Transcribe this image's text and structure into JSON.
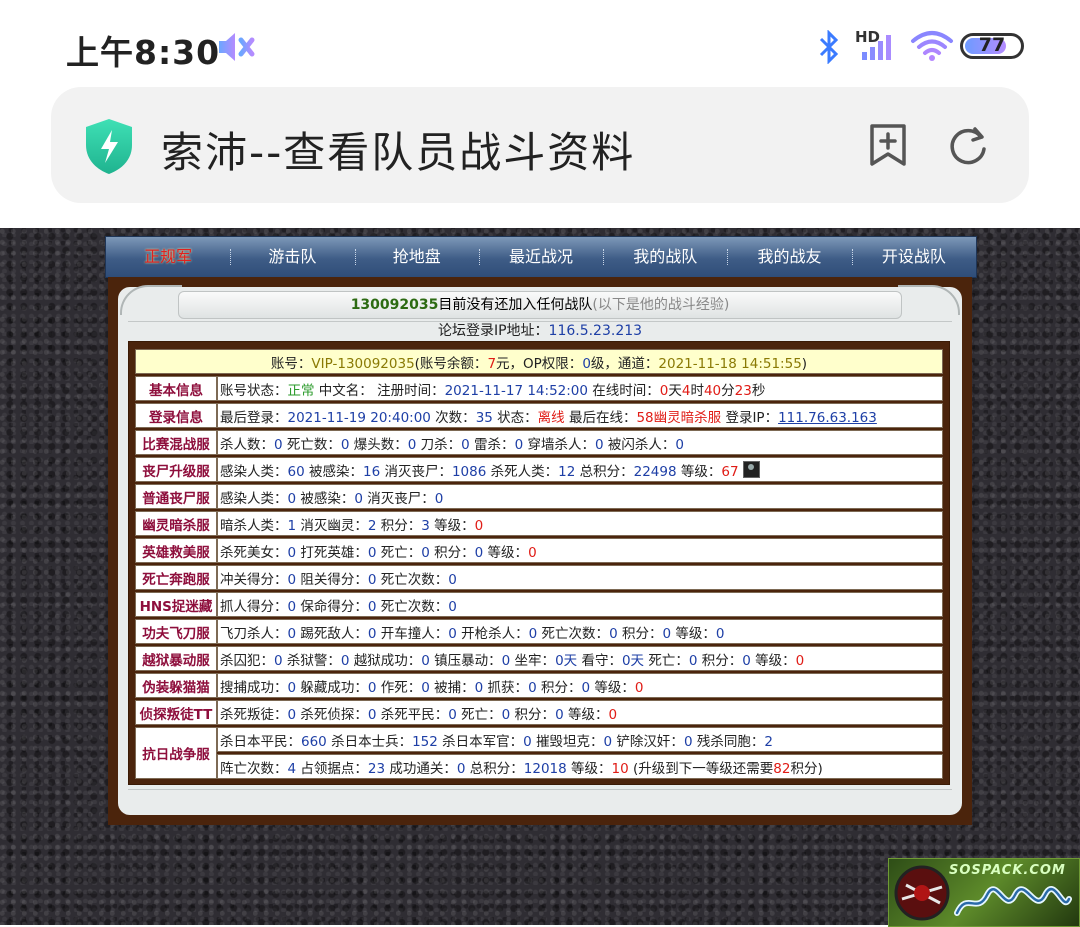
{
  "status_bar": {
    "time": "上午8:30",
    "network": "HD",
    "battery": "77"
  },
  "browser": {
    "title": "索沛--查看队员战斗资料"
  },
  "nav": {
    "items": [
      {
        "label": "正规军"
      },
      {
        "label": "游击队"
      },
      {
        "label": "抢地盘"
      },
      {
        "label": "最近战况"
      },
      {
        "label": "我的战队"
      },
      {
        "label": "我的战友"
      },
      {
        "label": "开设战队"
      }
    ]
  },
  "header": {
    "user_id": "130092035",
    "message": "目前没有还加入任何战队",
    "note": "(以下是他的战斗经验)",
    "ip_label": "论坛登录IP地址：",
    "ip_value": "116.5.23.213"
  },
  "account": {
    "l1": "账号：",
    "id": "VIP-130092035",
    "l2": "(账号余额：",
    "balance": "7",
    "l3": "元，OP权限：",
    "op": "0",
    "l4": "级，通道：",
    "time": "2021-11-18 14:51:55",
    "l5": ")"
  },
  "basic": {
    "label": "基本信息",
    "l1": "账号状态：",
    "status": "正常",
    "l2": " 中文名：  注册时间：",
    "reg": "2021-11-17 14:52:00",
    "l3": " 在线时间：",
    "d": "0",
    "l4": "天",
    "h": "4",
    "l5": "时",
    "m": "40",
    "l6": "分",
    "s": "23",
    "l7": "秒"
  },
  "login": {
    "label": "登录信息",
    "l1": "最后登录：",
    "last": "2021-11-19 20:40:00",
    "l2": " 次数：",
    "count": "35",
    "l3": " 状态：",
    "state": "离线",
    "l4": " 最后在线：",
    "server": "58幽灵暗杀服",
    "l5": " 登录IP：",
    "ip": "111.76.63.163"
  },
  "rows": {
    "r1": {
      "label": "比赛混战服",
      "t1": "杀人数：",
      "v1": "0",
      "t2": " 死亡数：",
      "v2": "0",
      "t3": " 爆头数：",
      "v3": "0",
      "t4": " 刀杀：",
      "v4": "0",
      "t5": " 雷杀：",
      "v5": "0",
      "t6": " 穿墙杀人：",
      "v6": "0",
      "t7": " 被闪杀人：",
      "v7": "0"
    },
    "r2": {
      "label": "丧尸升级服",
      "t1": "感染人类：",
      "v1": "60",
      "t2": " 被感染：",
      "v2": "16",
      "t3": " 消灭丧尸：",
      "v3": "1086",
      "t4": " 杀死人类：",
      "v4": "12",
      "t5": " 总积分：",
      "v5": "22498",
      "t6": " 等级：",
      "v6": "67"
    },
    "r3": {
      "label": "普通丧尸服",
      "t1": "感染人类：",
      "v1": "0",
      "t2": " 被感染：",
      "v2": "0",
      "t3": " 消灭丧尸：",
      "v3": "0"
    },
    "r4": {
      "label": "幽灵暗杀服",
      "t1": "暗杀人类：",
      "v1": "1",
      "t2": " 消灭幽灵：",
      "v2": "2",
      "t3": " 积分：",
      "v3": "3",
      "t4": " 等级：",
      "v4": "0"
    },
    "r5": {
      "label": "英雄救美服",
      "t1": "杀死美女：",
      "v1": "0",
      "t2": " 打死英雄：",
      "v2": "0",
      "t3": " 死亡：",
      "v3": "0",
      "t4": " 积分：",
      "v4": "0",
      "t5": " 等级：",
      "v5": "0"
    },
    "r6": {
      "label": "死亡奔跑服",
      "t1": "冲关得分：",
      "v1": "0",
      "t2": " 阻关得分：",
      "v2": "0",
      "t3": " 死亡次数：",
      "v3": "0"
    },
    "r7": {
      "label": "HNS捉迷藏",
      "t1": "抓人得分：",
      "v1": "0",
      "t2": " 保命得分：",
      "v2": "0",
      "t3": " 死亡次数：",
      "v3": "0"
    },
    "r8": {
      "label": "功夫飞刀服",
      "t1": "飞刀杀人：",
      "v1": "0",
      "t2": " 踢死敌人：",
      "v2": "0",
      "t3": " 开车撞人：",
      "v3": "0",
      "t4": " 开枪杀人：",
      "v4": "0",
      "t5": " 死亡次数：",
      "v5": "0",
      "t6": " 积分：",
      "v6": "0",
      "t7": " 等级：",
      "v7": "0"
    },
    "r9": {
      "label": "越狱暴动服",
      "t1": "杀囚犯：",
      "v1": "0",
      "t2": " 杀狱警：",
      "v2": "0",
      "t3": " 越狱成功：",
      "v3": "0",
      "t4": " 镇压暴动：",
      "v4": "0",
      "t5": " 坐牢：",
      "v5": "0",
      "t5b": "天",
      "t6": " 看守：",
      "v6": "0",
      "t6b": "天",
      "t7": " 死亡：",
      "v7": "0",
      "t8": " 积分：",
      "v8": "0",
      "t9": " 等级：",
      "v9": "0"
    },
    "r10": {
      "label": "伪装躲猫猫",
      "t1": "搜捕成功：",
      "v1": "0",
      "t2": " 躲藏成功：",
      "v2": "0",
      "t3": " 作死：",
      "v3": "0",
      "t4": " 被捕：",
      "v4": "0",
      "t5": " 抓获：",
      "v5": "0",
      "t6": " 积分：",
      "v6": "0",
      "t7": " 等级：",
      "v7": "0"
    },
    "r11": {
      "label": "侦探叛徒TT",
      "t1": "杀死叛徒：",
      "v1": "0",
      "t2": " 杀死侦探：",
      "v2": "0",
      "t3": " 杀死平民：",
      "v3": "0",
      "t4": " 死亡：",
      "v4": "0",
      "t5": " 积分：",
      "v5": "0",
      "t6": " 等级：",
      "v6": "0"
    },
    "r12": {
      "label": "抗日战争服",
      "a": {
        "t1": "杀日本平民：",
        "v1": "660",
        "t2": " 杀日本士兵：",
        "v2": "152",
        "t3": " 杀日本军官：",
        "v3": "0",
        "t4": " 摧毁坦克：",
        "v4": "0",
        "t5": " 铲除汉奸：",
        "v5": "0",
        "t6": " 残杀同胞：",
        "v6": "2"
      },
      "b": {
        "t1": "阵亡次数：",
        "v1": "4",
        "t2": " 占领据点：",
        "v2": "23",
        "t3": " 成功通关：",
        "v3": "0",
        "t4": " 总积分：",
        "v4": "12018",
        "t5": " 等级：",
        "v5": "10",
        "t6": " (升级到下一等级还需要",
        "v6": "82",
        "t7": "积分)"
      }
    }
  },
  "watermark": {
    "text": "SOSPACK.COM"
  },
  "colors": {
    "nav_bg": "#3e5c86",
    "panel_frame": "#4b240c",
    "label_color": "#8e0e3c",
    "value_blue": "#1e3fa6",
    "value_red": "#e01c16"
  }
}
